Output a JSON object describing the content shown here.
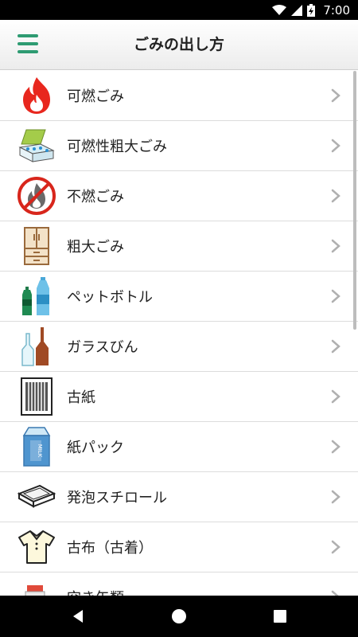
{
  "status_bar": {
    "time": "7:00"
  },
  "header": {
    "title": "ごみの出し方",
    "menu_icon": "hamburger-menu-icon"
  },
  "items": [
    {
      "label": "可燃ごみ",
      "icon": "fire-icon"
    },
    {
      "label": "可燃性粗大ごみ",
      "icon": "books-bundle-icon"
    },
    {
      "label": "不燃ごみ",
      "icon": "no-burn-icon"
    },
    {
      "label": "粗大ごみ",
      "icon": "cabinet-icon"
    },
    {
      "label": "ペットボトル",
      "icon": "pet-bottle-icon"
    },
    {
      "label": "ガラスびん",
      "icon": "glass-bottle-icon"
    },
    {
      "label": "古紙",
      "icon": "newspaper-icon"
    },
    {
      "label": "紙パック",
      "icon": "milk-carton-icon"
    },
    {
      "label": "発泡スチロール",
      "icon": "foam-tray-icon"
    },
    {
      "label": "古布（古着）",
      "icon": "shirt-icon"
    },
    {
      "label": "空き缶類",
      "icon": "can-icon"
    }
  ],
  "colors": {
    "accent": "#2e9b72"
  }
}
